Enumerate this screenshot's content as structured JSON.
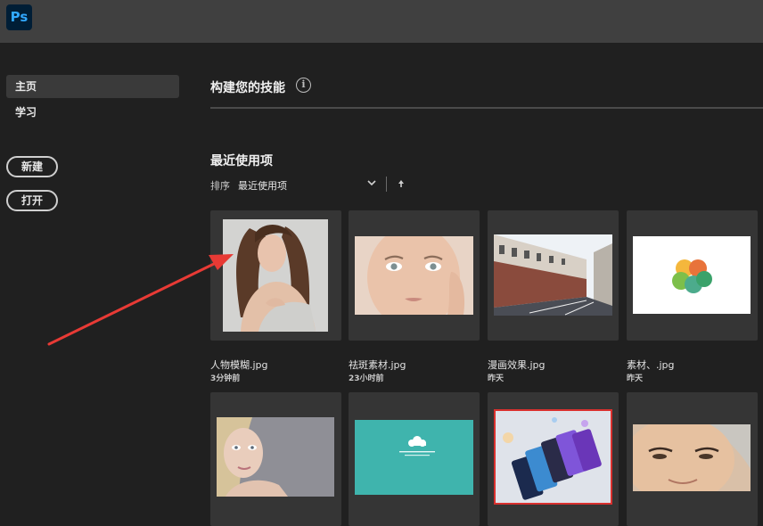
{
  "app": {
    "logo_text": "Ps"
  },
  "sidebar": {
    "items": [
      {
        "label": "主页",
        "active": true
      },
      {
        "label": "学习",
        "active": false
      }
    ],
    "buttons": {
      "new_label": "新建",
      "open_label": "打开"
    }
  },
  "main": {
    "skills_title": "构建您的技能",
    "info_icon": "info-icon",
    "recent_title": "最近使用项",
    "sort": {
      "label": "排序",
      "value": "最近使用项"
    }
  },
  "files": [
    {
      "name": "人物模糊.jpg",
      "time": "3分钟前"
    },
    {
      "name": "祛斑素材.jpg",
      "time": "23小时前"
    },
    {
      "name": "漫画效果.jpg",
      "time": "昨天"
    },
    {
      "name": "素材、.jpg",
      "time": "昨天"
    }
  ],
  "colors": {
    "accent_logo": "#31a8ff",
    "logo_bg": "#001e36",
    "annotation_arrow": "#e83a35"
  }
}
